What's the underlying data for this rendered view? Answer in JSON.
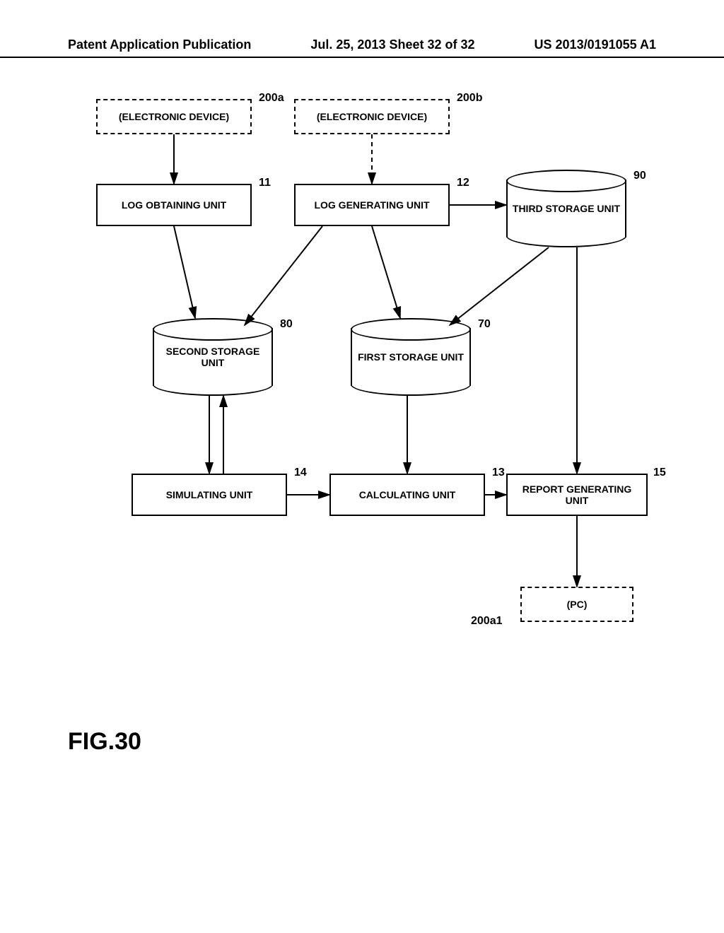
{
  "header": {
    "left": "Patent Application Publication",
    "center": "Jul. 25, 2013  Sheet 32 of 32",
    "right": "US 2013/0191055 A1"
  },
  "refs": {
    "dev_a": "200a",
    "dev_b": "200b",
    "pc": "200a1",
    "log_obtain": "11",
    "log_gen": "12",
    "calc": "13",
    "sim": "14",
    "report": "15",
    "first_store": "70",
    "second_store": "80",
    "third_store": "90"
  },
  "labels": {
    "dev_a": "(ELECTRONIC DEVICE)",
    "dev_b": "(ELECTRONIC DEVICE)",
    "pc": "(PC)",
    "log_obtain": "LOG OBTAINING UNIT",
    "log_gen": "LOG GENERATING UNIT",
    "calc": "CALCULATING UNIT",
    "sim": "SIMULATING UNIT",
    "report": "REPORT GENERATING UNIT",
    "first_store": "FIRST STORAGE UNIT",
    "second_store": "SECOND STORAGE UNIT",
    "third_store": "THIRD STORAGE UNIT"
  },
  "figure": "FIG.30"
}
